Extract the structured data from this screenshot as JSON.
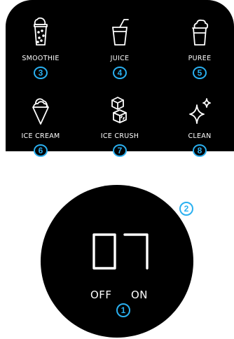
{
  "programs": [
    {
      "label": "SMOOTHIE",
      "icon": "smoothie-cup-icon",
      "callout": "3"
    },
    {
      "label": "JUICE",
      "icon": "juice-glass-icon",
      "callout": "4"
    },
    {
      "label": "PUREE",
      "icon": "puree-cup-icon",
      "callout": "5"
    },
    {
      "label": "ICE CREAM",
      "icon": "ice-cream-cone-icon",
      "callout": "6"
    },
    {
      "label": "ICE CRUSH",
      "icon": "ice-cubes-icon",
      "callout": "7"
    },
    {
      "label": "CLEAN",
      "icon": "sparkle-icon",
      "callout": "8"
    }
  ],
  "dial": {
    "display_value": "07",
    "off_label": "OFF",
    "on_label": "ON",
    "callout": "1"
  },
  "dial_callout": "2",
  "colors": {
    "panel": "#000000",
    "text": "#ffffff",
    "callout": "#2ab0f0"
  }
}
